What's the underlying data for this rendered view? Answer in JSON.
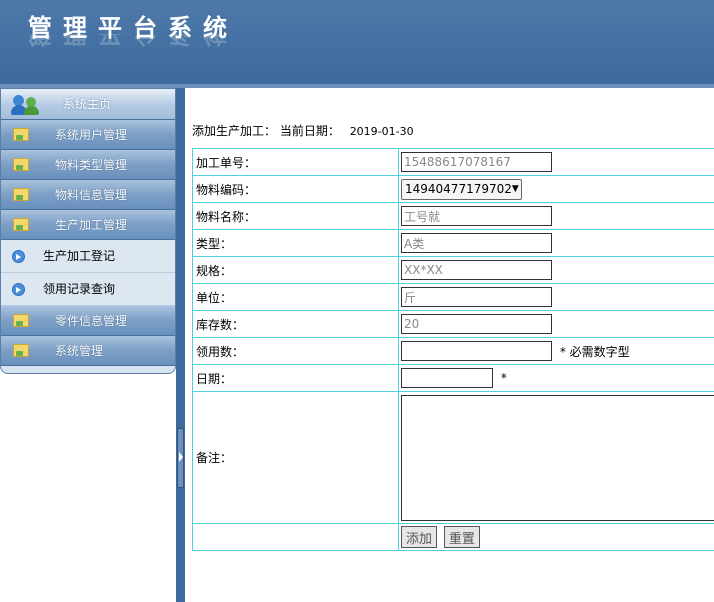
{
  "app": {
    "title": "管理平台系统"
  },
  "sidebar": {
    "home": "系统主页",
    "items": [
      {
        "label": "系统用户管理",
        "type": "group"
      },
      {
        "label": "物料类型管理",
        "type": "group"
      },
      {
        "label": "物料信息管理",
        "type": "group"
      },
      {
        "label": "生产加工管理",
        "type": "group"
      },
      {
        "label": "生产加工登记",
        "type": "sub"
      },
      {
        "label": "领用记录查询",
        "type": "sub"
      },
      {
        "label": "零件信息管理",
        "type": "group"
      },
      {
        "label": "系统管理",
        "type": "group"
      }
    ]
  },
  "page": {
    "heading": "添加生产加工：",
    "date_label": "当前日期：",
    "date_value": "2019-01-30"
  },
  "form": {
    "order_no": {
      "label": "加工单号：",
      "value": "15488617078167"
    },
    "material_code": {
      "label": "物料编码：",
      "value": "14940477179702"
    },
    "material_name": {
      "label": "物料名称：",
      "value": "工号就"
    },
    "type": {
      "label": "类型：",
      "value": "A类"
    },
    "spec": {
      "label": "规格：",
      "value": "XX*XX"
    },
    "unit": {
      "label": "单位：",
      "value": "斤"
    },
    "stock": {
      "label": "库存数：",
      "value": "20"
    },
    "quantity": {
      "label": "领用数：",
      "value": "",
      "hint": "* 必需数字型"
    },
    "date": {
      "label": "日期：",
      "value": "",
      "hint": "*"
    },
    "remark": {
      "label": "备注：",
      "value": ""
    }
  },
  "buttons": {
    "add": "添加",
    "reset": "重置"
  }
}
